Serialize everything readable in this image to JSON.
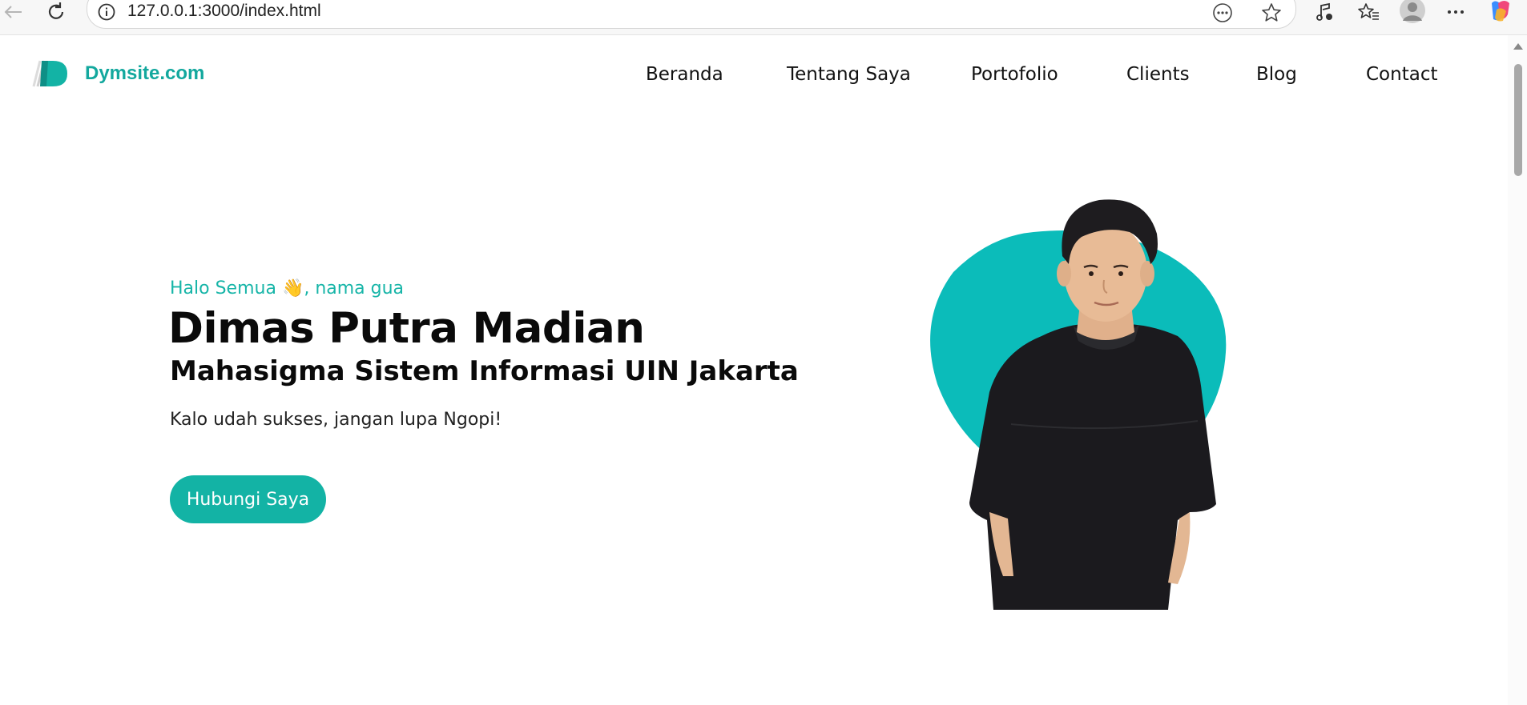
{
  "browser": {
    "url": "127.0.0.1:3000/index.html"
  },
  "site": {
    "brand": "Dymsite.com",
    "accent_color": "#13b3a5",
    "nav": [
      {
        "label": "Beranda"
      },
      {
        "label": "Tentang Saya"
      },
      {
        "label": "Portofolio"
      },
      {
        "label": "Clients"
      },
      {
        "label": "Blog"
      },
      {
        "label": "Contact"
      }
    ]
  },
  "hero": {
    "greeting": "Halo Semua 👋, nama gua",
    "name": "Dimas Putra Madian",
    "role": "Mahasigma Sistem Informasi UIN Jakarta",
    "tagline": "Kalo udah sukses, jangan lupa Ngopi!",
    "cta_label": "Hubungi Saya"
  }
}
